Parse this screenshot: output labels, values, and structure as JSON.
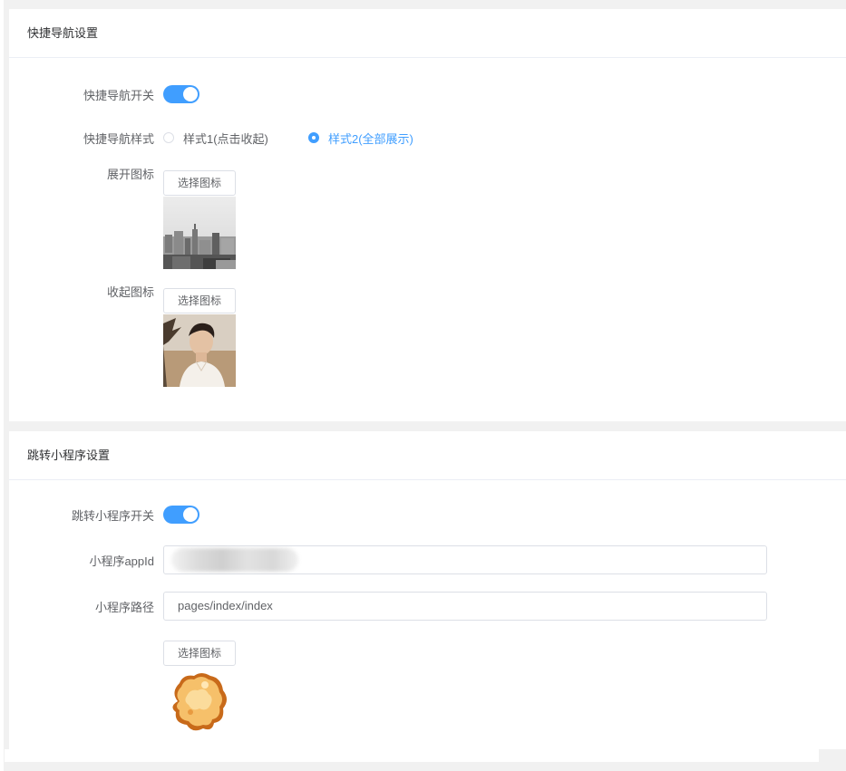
{
  "quick_nav": {
    "title": "快捷导航设置",
    "switch_label": "快捷导航开关",
    "switch_on": true,
    "style_label": "快捷导航样式",
    "style_options": [
      {
        "label": "样式1(点击收起)",
        "checked": false
      },
      {
        "label": "样式2(全部展示)",
        "checked": true
      }
    ],
    "expand_icon_label": "展开图标",
    "collapse_icon_label": "收起图标",
    "choose_icon_button": "选择图标"
  },
  "mini_program": {
    "title": "跳转小程序设置",
    "switch_label": "跳转小程序开关",
    "switch_on": true,
    "appid_label": "小程序appId",
    "appid_value": "",
    "path_label": "小程序路径",
    "path_value": "pages/index/index",
    "choose_icon_button": "选择图标"
  },
  "colors": {
    "accent": "#409eff",
    "border": "#dcdfe6",
    "text": "#606266"
  }
}
